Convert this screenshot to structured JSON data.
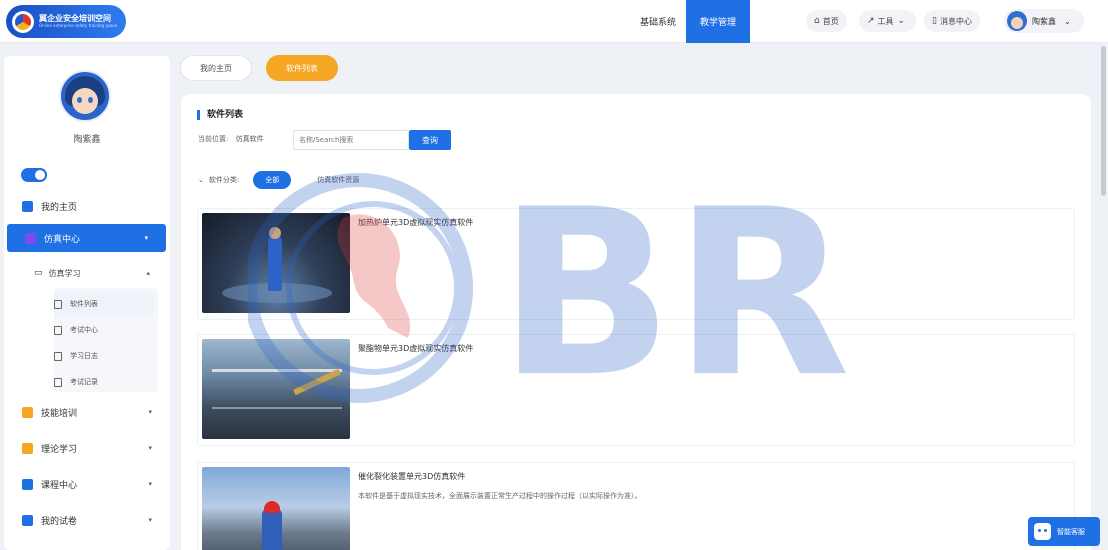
{
  "header": {
    "logo_title": "冀企业安全培训空间",
    "logo_subtitle": "Online enterprise safety training space",
    "nav": [
      {
        "label": "基础系统",
        "active": false
      },
      {
        "label": "教学管理",
        "active": true
      }
    ],
    "home_label": "首页",
    "tools_label": "工具",
    "messages_label": "消息中心",
    "user_name": "陶紫鑫"
  },
  "sidebar": {
    "user_name": "陶紫鑫",
    "items": [
      {
        "label": "我的主页",
        "icon": "house-icon",
        "color": "#1f6fe5"
      },
      {
        "label": "仿真中心",
        "icon": "monitor-icon",
        "color": "#7a4df2",
        "active": true
      },
      {
        "label": "技能培训",
        "icon": "briefcase-icon",
        "color": "#f5a623"
      },
      {
        "label": "理论学习",
        "icon": "book-icon",
        "color": "#f5a623"
      },
      {
        "label": "课程中心",
        "icon": "folder-icon",
        "color": "#1f6fe5"
      },
      {
        "label": "我的试卷",
        "icon": "paper-icon",
        "color": "#1f6fe5"
      }
    ],
    "sub": {
      "label": "仿真学习",
      "icon": "monitor-icon"
    },
    "leaves": [
      {
        "label": "软件列表",
        "active": true
      },
      {
        "label": "考试中心",
        "active": false
      },
      {
        "label": "学习日志",
        "active": false
      },
      {
        "label": "考试记录",
        "active": false
      }
    ]
  },
  "tabs": [
    {
      "label": "我的主页",
      "active": false
    },
    {
      "label": "软件列表",
      "active": true
    }
  ],
  "panel": {
    "title": "软件列表",
    "crumb_label": "当前位置:",
    "crumb_current": "仿真软件",
    "search_placeholder": "名称/Search搜索",
    "search_button": "查询",
    "filter_label": "软件分类:",
    "filter_all": "全部",
    "filter_other": "仿真软件资源"
  },
  "cards": [
    {
      "title": "加热炉单元3D虚拟现实仿真软件",
      "desc": ""
    },
    {
      "title": "聚酯物单元3D虚拟现实仿真软件",
      "desc": ""
    },
    {
      "title": "催化裂化装置单元3D仿真软件",
      "desc": "本软件是基于虚拟现实技术，全面展示装置正常生产过程中的操作过程（以实际操作为准）。"
    }
  ],
  "watermark_text": "BR",
  "chat_label": "智能客服",
  "colors": {
    "primary": "#1f6fe5",
    "accent": "#f5a623",
    "bg": "#eef1f6"
  }
}
